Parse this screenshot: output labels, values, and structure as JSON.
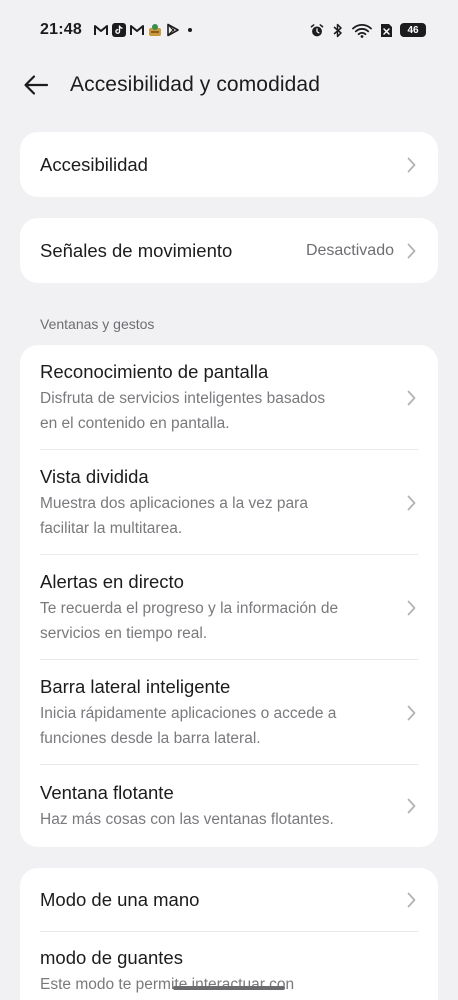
{
  "status_bar": {
    "time": "21:48",
    "notification_icons": [
      "gmail-icon",
      "tiktok-icon",
      "gmail-icon",
      "app-icon",
      "play-store-icon"
    ],
    "system_icons": [
      "alarm-icon",
      "bluetooth-icon",
      "wifi-icon",
      "no-sim-icon",
      "battery-icon"
    ],
    "battery": "46"
  },
  "header": {
    "title": "Accesibilidad y comodidad"
  },
  "items": {
    "accesibilidad": {
      "title": "Accesibilidad"
    },
    "senales": {
      "title": "Señales de movimiento",
      "value": "Desactivado"
    }
  },
  "section_ventanas": {
    "label": "Ventanas y gestos",
    "items": [
      {
        "title": "Reconocimiento de pantalla",
        "desc1": "Disfruta de servicios inteligentes basados",
        "desc2": "en el contenido en pantalla."
      },
      {
        "title": "Vista dividida",
        "desc1": "Muestra dos aplicaciones a la vez para",
        "desc2": "facilitar la multitarea."
      },
      {
        "title": "Alertas en directo",
        "desc1": "Te recuerda el progreso y la información de",
        "desc2": "servicios en tiempo real."
      },
      {
        "title": "Barra lateral inteligente",
        "desc1": "Inicia rápidamente aplicaciones o accede a",
        "desc2": "funciones desde la barra lateral."
      },
      {
        "title": "Ventana flotante",
        "desc1": "Haz más cosas con las ventanas flotantes."
      }
    ]
  },
  "section_mano": {
    "items": [
      {
        "title": "Modo de una mano"
      },
      {
        "title": "modo de guantes",
        "desc1": "Este modo te permite interactuar con"
      }
    ]
  },
  "colors": {
    "background": "#f1f1f3",
    "card": "#ffffff",
    "text_primary": "#1c1c1e",
    "text_secondary": "#7a7a7e"
  }
}
